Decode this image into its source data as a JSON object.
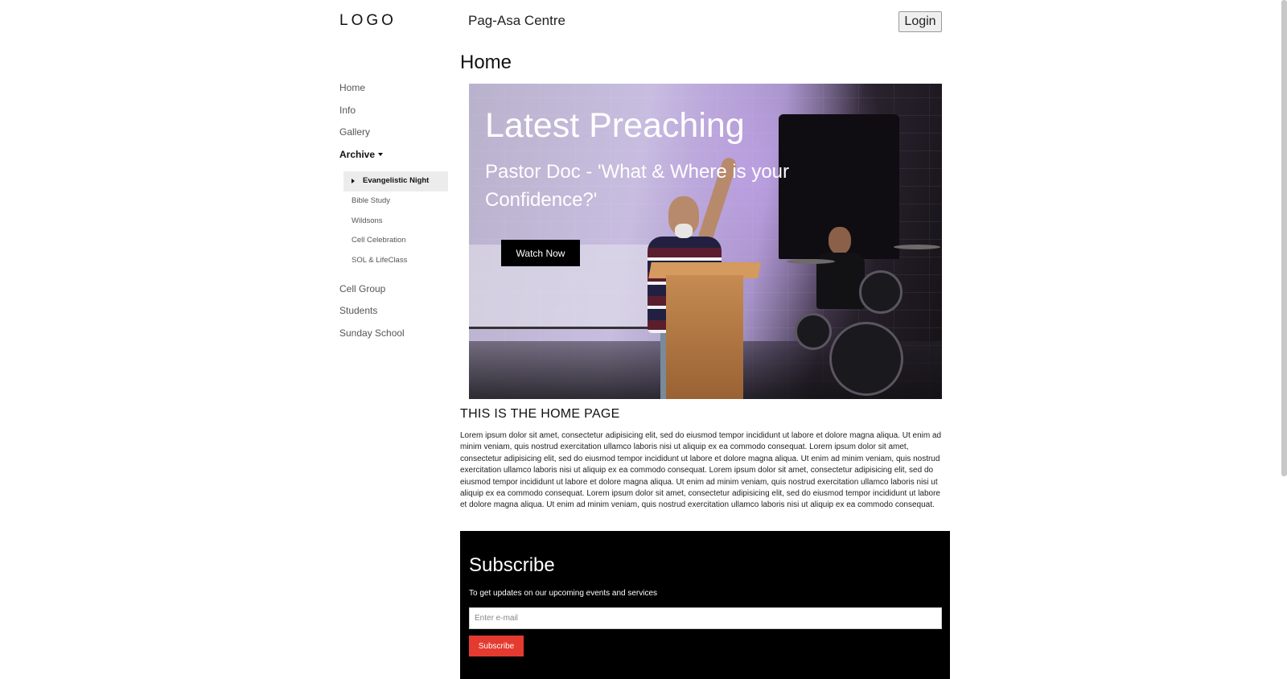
{
  "header": {
    "logo": "LOGO",
    "site_title": "Pag-Asa Centre",
    "login_label": "Login"
  },
  "sidebar": {
    "items": [
      {
        "label": "Home"
      },
      {
        "label": "Info"
      },
      {
        "label": "Gallery"
      },
      {
        "label": "Archive",
        "expanded": true
      },
      {
        "label": "Cell Group"
      },
      {
        "label": "Students"
      },
      {
        "label": "Sunday School"
      }
    ],
    "archive_sub": [
      {
        "label": "Evangelistic Night",
        "selected": true
      },
      {
        "label": "Bible Study"
      },
      {
        "label": "Wildsons"
      },
      {
        "label": "Cell Celebration"
      },
      {
        "label": "SOL & LifeClass"
      }
    ]
  },
  "main": {
    "page_title": "Home",
    "hero": {
      "title": "Latest Preaching",
      "subtitle": "Pastor Doc - 'What & Where is your Confidence?'",
      "button_label": "Watch Now"
    },
    "section_title": "THIS IS THE HOME PAGE",
    "body_text": "Lorem ipsum dolor sit amet, consectetur adipisicing elit, sed do eiusmod tempor incididunt ut labore et dolore magna aliqua. Ut enim ad minim veniam, quis nostrud exercitation ullamco laboris nisi ut aliquip ex ea commodo consequat. Lorem ipsum dolor sit amet, consectetur adipisicing elit, sed do eiusmod tempor incididunt ut labore et dolore magna aliqua. Ut enim ad minim veniam, quis nostrud exercitation ullamco laboris nisi ut aliquip ex ea commodo consequat. Lorem ipsum dolor sit amet, consectetur adipisicing elit, sed do eiusmod tempor incididunt ut labore et dolore magna aliqua. Ut enim ad minim veniam, quis nostrud exercitation ullamco laboris nisi ut aliquip ex ea commodo consequat. Lorem ipsum dolor sit amet, consectetur adipisicing elit, sed do eiusmod tempor incididunt ut labore et dolore magna aliqua. Ut enim ad minim veniam, quis nostrud exercitation ullamco laboris nisi ut aliquip ex ea commodo consequat."
  },
  "subscribe": {
    "title": "Subscribe",
    "text": "To get updates on our upcoming events and services",
    "email_placeholder": "Enter e-mail",
    "email_value": "",
    "button_label": "Subscribe"
  },
  "colors": {
    "subscribe_button": "#e53a2f",
    "subscribe_background": "#000000",
    "active_subitem_bg": "#ececec"
  }
}
